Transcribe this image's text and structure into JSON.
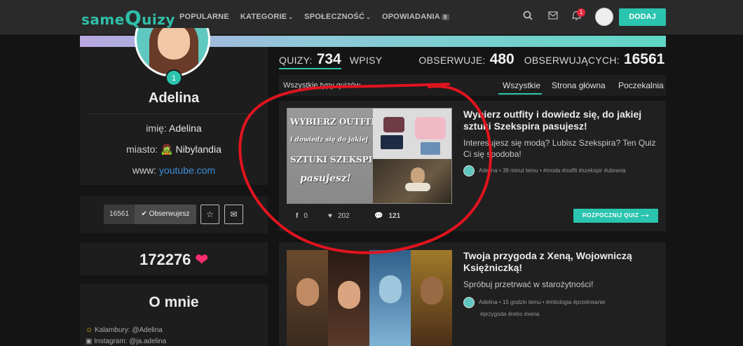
{
  "header": {
    "logo_part1": "same",
    "logo_big": "Q",
    "logo_part2": "uizy",
    "nav": [
      {
        "label": "POPULARNE"
      },
      {
        "label": "KATEGORIE",
        "caret": "⌄"
      },
      {
        "label": "SPOŁECZNOŚĆ",
        "caret": "⌄"
      },
      {
        "label": "OPOWIADANIA",
        "badge": "8"
      }
    ],
    "notification_count": "1",
    "add_button": "DODAJ"
  },
  "profile": {
    "level": "1",
    "name": "Adelina",
    "imie_label": "imię:",
    "imie_value": "Adelina",
    "miasto_label": "miasto:",
    "miasto_value": "🧟 Nibylandia",
    "www_label": "www:",
    "www_value": "youtube.com",
    "followers_count": "16561",
    "follow_button": "✔ Obserwujesz",
    "points": "172276",
    "about_title": "O mnie",
    "about_lines": [
      "Kalambury: @Adelina",
      "Instagram: @ja.adelina"
    ]
  },
  "stats": {
    "quizzes_label": "QUIZY:",
    "quizzes_value": "734",
    "posts_label": "WPISY",
    "following_label": "OBSERWUJE:",
    "following_value": "480",
    "followers_label": "OBSERWUJĄCYCH:",
    "followers_value": "16561"
  },
  "filters": {
    "type_select": "Wszystkie typy quizów",
    "tabs": [
      "Wszystkie",
      "Strona główna",
      "Poczekalnia"
    ],
    "active_tab": "Wszystkie"
  },
  "quizzes": [
    {
      "thumb_text": [
        "WYBIERZ OUTFITY",
        "i dowiedz się do jakiej",
        "SZTUKI SZEKSPIRA",
        "pasujesz!"
      ],
      "title": "Wybierz outfity i dowiedz się, do jakiej sztuki Szekspira pasujesz!",
      "description": "Interesujesz się modą? Lubisz Szekspira? Ten Quiz Ci się spodoba!",
      "author": "Adelina",
      "time": "39 minut temu",
      "tags": "#moda #outfit #szekspir #ubrania",
      "shares": "0",
      "likes": "202",
      "comments": "121",
      "start_button": "ROZPOCZNIJ QUIZ ⟶"
    },
    {
      "title": "Twoja przygoda z Xeną, Wojowniczą Księżniczką!",
      "description": "Spróbuj przetrwać w starożytności!",
      "author": "Adelina",
      "time": "15 godzin temu",
      "tags_line1": "#mitologia #przetrwanie",
      "tags_line2": "#przygoda #retro #xena"
    }
  ],
  "colors": {
    "accent": "#2bc4ae",
    "annotation": "#e0141f",
    "heart": "#ff2d6f"
  }
}
